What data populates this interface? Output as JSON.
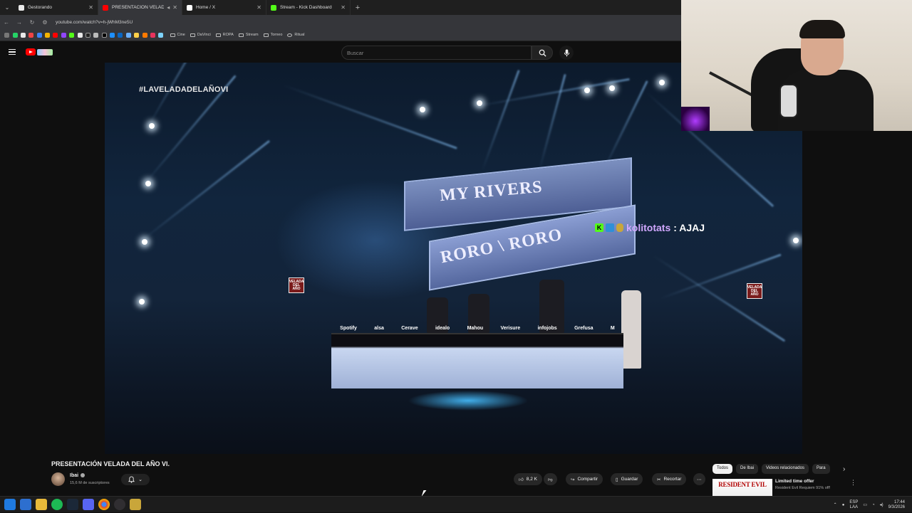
{
  "browser": {
    "tabs": [
      {
        "title": "Gestorando",
        "favicon_color": "#e8e8e8"
      },
      {
        "title": "PRESENTACIÓN VELADA DEL AÑO VI",
        "favicon_color": "#ff0000",
        "active": true
      },
      {
        "title": "Home / X",
        "favicon_color": "#ffffff"
      },
      {
        "title": "Stream - Kick Dashboard",
        "favicon_color": "#53fc18"
      }
    ],
    "url": "youtube.com/watch?v=h-jWhM3ne5U",
    "bookmark_folders": [
      "Cine",
      "DaVinci",
      "ROPA",
      "Stream",
      "Torneo",
      "Ritual"
    ]
  },
  "youtube": {
    "search_placeholder": "Buscar"
  },
  "video": {
    "hashtag": "#LAVELADADELAÑOVI",
    "screen_text_top": "MY RIVERS",
    "screen_text_bottom": "RORO  \\  RORO",
    "sponsors": [
      "Spotify",
      "alsa",
      "Cerave",
      "idealo",
      "Mahou",
      "Verisure",
      "infojobs",
      "Grefusa",
      "M"
    ],
    "velada_logo": "VELADA DEL AÑO",
    "chat": {
      "user": "kolitotats",
      "message": ": AJAJ"
    }
  },
  "info": {
    "title": "PRESENTACIÓN VELADA DEL AÑO VI.",
    "channel": "Ibai",
    "subscribers": "15,6 M de suscriptores",
    "likes": "8,2 K",
    "share": "Compartir",
    "save": "Guardar",
    "clip": "Recortar",
    "more": "⋯"
  },
  "sidebar": {
    "chips": [
      "Todos",
      "De Ibai",
      "Videos relacionados",
      "Para"
    ],
    "ad": {
      "thumb_text": "RESIDENT EVIL",
      "title": "Limited time offer",
      "subtitle": "Resident Evil Requiem 91% off!"
    }
  },
  "taskbar": {
    "lang_top": "ESP",
    "lang_bottom": "LAA",
    "time": "17:44",
    "date": "9/3/2026"
  }
}
